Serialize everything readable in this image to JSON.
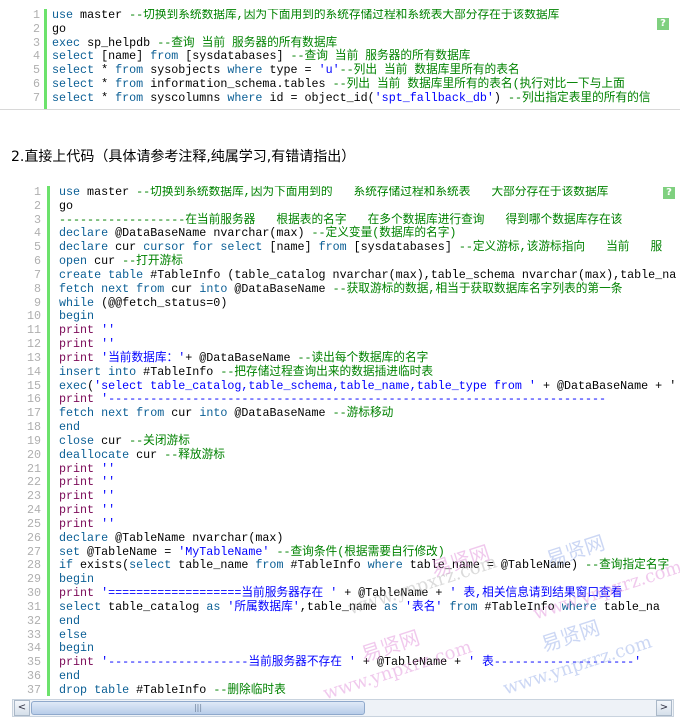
{
  "block1": {
    "lines": [
      [
        [
          "k",
          "use"
        ],
        [
          "n",
          " master "
        ],
        [
          "c",
          "--切换到系统数据库,因为下面用到的系统存储过程和系统表大部分存在于该数据库"
        ]
      ],
      [
        [
          "n",
          "go"
        ]
      ],
      [
        [
          "k",
          "exec"
        ],
        [
          "n",
          " sp_helpdb "
        ],
        [
          "c",
          "--查询 当前 服务器的所有数据库"
        ]
      ],
      [
        [
          "k",
          "select"
        ],
        [
          "n",
          " [name] "
        ],
        [
          "k",
          "from"
        ],
        [
          "n",
          " [sysdatabases] "
        ],
        [
          "c",
          "--查询 当前 服务器的所有数据库"
        ]
      ],
      [
        [
          "k",
          "select"
        ],
        [
          "n",
          " * "
        ],
        [
          "k",
          "from"
        ],
        [
          "n",
          " sysobjects "
        ],
        [
          "k",
          "where"
        ],
        [
          "n",
          " type = "
        ],
        [
          "s",
          "'u'"
        ],
        [
          "c",
          "--列出 当前 数据库里所有的表名"
        ]
      ],
      [
        [
          "k",
          "select"
        ],
        [
          "n",
          " * "
        ],
        [
          "k",
          "from"
        ],
        [
          "n",
          " information_schema.tables "
        ],
        [
          "c",
          "--列出 当前 数据库里所有的表名(执行对比一下与上面"
        ]
      ],
      [
        [
          "k",
          "select"
        ],
        [
          "n",
          " * "
        ],
        [
          "k",
          "from"
        ],
        [
          "n",
          " syscolumns "
        ],
        [
          "k",
          "where"
        ],
        [
          "n",
          " id = object_id("
        ],
        [
          "s",
          "'spt_fallback_db'"
        ],
        [
          "n",
          ") "
        ],
        [
          "c",
          "--列出指定表里的所有的信"
        ]
      ]
    ],
    "help_icon": "?"
  },
  "heading": "2.直接上代码（具体请参考注释,纯属学习,有错请指出）",
  "block2": {
    "help_icon": "?",
    "lines": [
      [
        [
          "k",
          "use"
        ],
        [
          "n",
          " master "
        ],
        [
          "c",
          "--切换到系统数据库,因为下面用到的   系统存储过程和系统表   大部分存在于该数据库"
        ]
      ],
      [
        [
          "n",
          "go"
        ]
      ],
      [
        [
          "c",
          "------------------在当前服务器   根据表的名字   在多个数据库进行查询   得到哪个数据库存在该"
        ]
      ],
      [
        [
          "k",
          "declare"
        ],
        [
          "n",
          " @DataBaseName nvarchar(max) "
        ],
        [
          "c",
          "--定义变量(数据库的名字)"
        ]
      ],
      [
        [
          "k",
          "declare"
        ],
        [
          "n",
          " cur "
        ],
        [
          "k",
          "cursor"
        ],
        [
          "n",
          " "
        ],
        [
          "k",
          "for"
        ],
        [
          "n",
          " "
        ],
        [
          "k",
          "select"
        ],
        [
          "n",
          " [name] "
        ],
        [
          "k",
          "from"
        ],
        [
          "n",
          " [sysdatabases] "
        ],
        [
          "c",
          "--定义游标,该游标指向   当前   服"
        ]
      ],
      [
        [
          "k",
          "open"
        ],
        [
          "n",
          " cur "
        ],
        [
          "c",
          "--打开游标"
        ]
      ],
      [
        [
          "k",
          "create"
        ],
        [
          "n",
          " "
        ],
        [
          "k",
          "table"
        ],
        [
          "n",
          " #TableInfo (table_catalog nvarchar(max),table_schema nvarchar(max),table_na"
        ]
      ],
      [
        [
          "k",
          "fetch"
        ],
        [
          "n",
          " "
        ],
        [
          "k",
          "next"
        ],
        [
          "n",
          " "
        ],
        [
          "k",
          "from"
        ],
        [
          "n",
          " cur "
        ],
        [
          "k",
          "into"
        ],
        [
          "n",
          " @DataBaseName "
        ],
        [
          "c",
          "--获取游标的数据,相当于获取数据库名字列表的第一条"
        ]
      ],
      [
        [
          "k",
          "while"
        ],
        [
          "n",
          " (@@fetch_status=0)"
        ]
      ],
      [
        [
          "k",
          "begin"
        ]
      ],
      [
        [
          "p",
          "print"
        ],
        [
          "n",
          " "
        ],
        [
          "s",
          "''"
        ]
      ],
      [
        [
          "p",
          "print"
        ],
        [
          "n",
          " "
        ],
        [
          "s",
          "''"
        ]
      ],
      [
        [
          "p",
          "print"
        ],
        [
          "n",
          " "
        ],
        [
          "s",
          "'当前数据库：'"
        ],
        [
          "n",
          "+ @DataBaseName "
        ],
        [
          "c",
          "--读出每个数据库的名字"
        ]
      ],
      [
        [
          "k",
          "insert"
        ],
        [
          "n",
          " "
        ],
        [
          "k",
          "into"
        ],
        [
          "n",
          " #TableInfo "
        ],
        [
          "c",
          "--把存储过程查询出来的数据插进临时表"
        ]
      ],
      [
        [
          "k",
          "exec"
        ],
        [
          "n",
          "("
        ],
        [
          "s",
          "'select table_catalog,table_schema,table_name,table_type from '"
        ],
        [
          "n",
          " + @DataBaseName + '"
        ]
      ],
      [
        [
          "p",
          "print"
        ],
        [
          "n",
          " "
        ],
        [
          "s",
          "'-----------------------------------------------------------------------"
        ]
      ],
      [
        [
          "k",
          "fetch"
        ],
        [
          "n",
          " "
        ],
        [
          "k",
          "next"
        ],
        [
          "n",
          " "
        ],
        [
          "k",
          "from"
        ],
        [
          "n",
          " cur "
        ],
        [
          "k",
          "into"
        ],
        [
          "n",
          " @DataBaseName "
        ],
        [
          "c",
          "--游标移动"
        ]
      ],
      [
        [
          "k",
          "end"
        ]
      ],
      [
        [
          "k",
          "close"
        ],
        [
          "n",
          " cur "
        ],
        [
          "c",
          "--关闭游标"
        ]
      ],
      [
        [
          "k",
          "deallocate"
        ],
        [
          "n",
          " cur "
        ],
        [
          "c",
          "--释放游标"
        ]
      ],
      [
        [
          "p",
          "print"
        ],
        [
          "n",
          " "
        ],
        [
          "s",
          "''"
        ]
      ],
      [
        [
          "p",
          "print"
        ],
        [
          "n",
          " "
        ],
        [
          "s",
          "''"
        ]
      ],
      [
        [
          "p",
          "print"
        ],
        [
          "n",
          " "
        ],
        [
          "s",
          "''"
        ]
      ],
      [
        [
          "p",
          "print"
        ],
        [
          "n",
          " "
        ],
        [
          "s",
          "''"
        ]
      ],
      [
        [
          "p",
          "print"
        ],
        [
          "n",
          " "
        ],
        [
          "s",
          "''"
        ]
      ],
      [
        [
          "k",
          "declare"
        ],
        [
          "n",
          " @TableName nvarchar(max)"
        ]
      ],
      [
        [
          "k",
          "set"
        ],
        [
          "n",
          " @TableName = "
        ],
        [
          "s",
          "'MyTableName'"
        ],
        [
          "n",
          " "
        ],
        [
          "c",
          "--查询条件(根据需要自行修改)"
        ]
      ],
      [
        [
          "k",
          "if"
        ],
        [
          "n",
          " exists("
        ],
        [
          "k",
          "select"
        ],
        [
          "n",
          " table_name "
        ],
        [
          "k",
          "from"
        ],
        [
          "n",
          " #TableInfo "
        ],
        [
          "k",
          "where"
        ],
        [
          "n",
          " table_name = @TableName) "
        ],
        [
          "c",
          "--查询指定名字"
        ]
      ],
      [
        [
          "k",
          "begin"
        ]
      ],
      [
        [
          "p",
          "print"
        ],
        [
          "n",
          " "
        ],
        [
          "s",
          "'===================当前服务器存在 '"
        ],
        [
          "n",
          " + @TableName + "
        ],
        [
          "s",
          "' 表,相关信息请到结果窗口查看"
        ]
      ],
      [
        [
          "k",
          "select"
        ],
        [
          "n",
          " table_catalog "
        ],
        [
          "k",
          "as"
        ],
        [
          "n",
          " "
        ],
        [
          "s",
          "'所属数据库'"
        ],
        [
          "n",
          ",table_name "
        ],
        [
          "k",
          "as"
        ],
        [
          "n",
          " "
        ],
        [
          "s",
          "'表名'"
        ],
        [
          "n",
          " "
        ],
        [
          "k",
          "from"
        ],
        [
          "n",
          " #TableInfo "
        ],
        [
          "k",
          "where"
        ],
        [
          "n",
          " table_na"
        ]
      ],
      [
        [
          "k",
          "end"
        ]
      ],
      [
        [
          "k",
          "else"
        ]
      ],
      [
        [
          "k",
          "begin"
        ]
      ],
      [
        [
          "p",
          "print"
        ],
        [
          "n",
          " "
        ],
        [
          "s",
          "'--------------------当前服务器不存在 '"
        ],
        [
          "n",
          " + @TableName + "
        ],
        [
          "s",
          "' 表--------------------'"
        ]
      ],
      [
        [
          "k",
          "end"
        ]
      ],
      [
        [
          "k",
          "drop"
        ],
        [
          "n",
          " "
        ],
        [
          "k",
          "table"
        ],
        [
          "n",
          " #TableInfo "
        ],
        [
          "c",
          "--删除临时表"
        ]
      ]
    ]
  },
  "scrollbar": {
    "left_arrow": "<",
    "right_arrow": ">",
    "thumb_grip": "|||"
  },
  "watermark": {
    "brand": "易贤网",
    "url": "www.ynpxrz.com",
    "colors": {
      "pink": "#e08ad8",
      "blue": "#8fa8e8"
    }
  },
  "colors": {
    "keyword": "#0b5f95",
    "print": "#7b0a58",
    "string": "#0000ff",
    "comment": "#008200",
    "gutter_bar": "#6ce26c",
    "line_number": "#afafaf"
  }
}
